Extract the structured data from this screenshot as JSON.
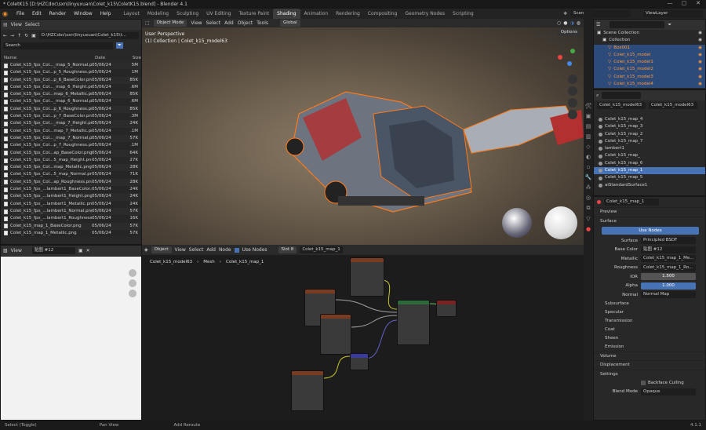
{
  "window": {
    "title": "* ColetK15 [D:\\HZCdoc\\sxn\\linyuxuan\\Colet_k15\\ColetK15.blend] - Blender 4.1"
  },
  "menus": [
    "File",
    "Edit",
    "Render",
    "Window",
    "Help"
  ],
  "workspaces": [
    "Layout",
    "Modeling",
    "Sculpting",
    "UV Editing",
    "Texture Paint",
    "Shading",
    "Animation",
    "Rendering",
    "Compositing",
    "Geometry Nodes",
    "Scripting"
  ],
  "active_workspace": "Shading",
  "scene": {
    "scene_name": "Scene",
    "view_layer": "ViewLayer"
  },
  "file_browser": {
    "view_label": "View",
    "select_label": "Select",
    "path": "D:\\HZCdoc\\sxn\\linyuxuan\\Colet_k15\\t...",
    "search_placeholder": "Search",
    "columns": [
      "Name",
      "Date",
      "Size"
    ],
    "files": [
      {
        "name": "Colet_k15_fpx_Col..._map_5_Normal.png",
        "date": "05/06/24",
        "size": "5M"
      },
      {
        "name": "Colet_k15_fpx_Col...p_5_Roughness.png",
        "date": "05/06/24",
        "size": "1M"
      },
      {
        "name": "Colet_k15_fpx_Col...p_6_BaseColor.png",
        "date": "05/06/24",
        "size": "85K"
      },
      {
        "name": "Colet_k15_fpx_Col..._map_6_Height.png",
        "date": "05/06/24",
        "size": ".6M"
      },
      {
        "name": "Colet_k15_fpx_Col...map_6_Metallic.png",
        "date": "05/06/24",
        "size": "85K"
      },
      {
        "name": "Colet_k15_fpx_Col..._map_6_Normal.png",
        "date": "05/06/24",
        "size": ".6M"
      },
      {
        "name": "Colet_k15_fpx_Col...p_6_Roughness.png",
        "date": "05/06/24",
        "size": "85K"
      },
      {
        "name": "Colet_k15_fpx_Col...p_7_BaseColor.png",
        "date": "05/06/24",
        "size": ".3M"
      },
      {
        "name": "Colet_k15_fpx_Col..._map_7_Height.png",
        "date": "05/06/24",
        "size": "24K"
      },
      {
        "name": "Colet_k15_fpx_Col...map_7_Metallic.png",
        "date": "05/06/24",
        "size": ".1M"
      },
      {
        "name": "Colet_k15_fpx_Col..._map_7_Normal.png",
        "date": "05/06/24",
        "size": "57K"
      },
      {
        "name": "Colet_k15_fpx_Col...p_7_Roughness.png",
        "date": "05/06/24",
        "size": ".1M"
      },
      {
        "name": "Colet_k15_fpx_Col...ap_BaseColor.png",
        "date": "05/06/24",
        "size": "64K"
      },
      {
        "name": "Colet_k15_fpx_Col...5_map_Height.png",
        "date": "05/06/24",
        "size": "27K"
      },
      {
        "name": "Colet_k15_fpx_Col...map_Metallic.png",
        "date": "05/06/24",
        "size": "28K"
      },
      {
        "name": "Colet_k15_fpx_Col...5_map_Normal.png",
        "date": "05/06/24",
        "size": "71K"
      },
      {
        "name": "Colet_k15_fpx_Col...ap_Roughness.png",
        "date": "05/06/24",
        "size": "28K"
      },
      {
        "name": "Colet_k15_fpx_...lambert1_BaseColor.png",
        "date": "05/06/24",
        "size": "24K"
      },
      {
        "name": "Colet_k15_fpx_...lambert1_Height.png",
        "date": "05/06/24",
        "size": "24K"
      },
      {
        "name": "Colet_k15_fpx_...lambert1_Metallic.png",
        "date": "05/06/24",
        "size": "24K"
      },
      {
        "name": "Colet_k15_fpx_...lambert1_Normal.png",
        "date": "05/06/24",
        "size": "57K"
      },
      {
        "name": "Colet_k15_fpx_...lambert1_Roughness.png",
        "date": "05/06/24",
        "size": "16K"
      },
      {
        "name": "Colet_k15_map_1_BaseColor.png",
        "date": "05/06/24",
        "size": "57K"
      },
      {
        "name": "Colet_k15_map_1_Metallic.png",
        "date": "05/06/24",
        "size": "57K"
      }
    ]
  },
  "image_editor": {
    "view_label": "View",
    "image_name": "贴图 #12"
  },
  "viewport": {
    "mode": "Object Mode",
    "menus": [
      "View",
      "Select",
      "Add",
      "Object",
      "Tools"
    ],
    "orientation": "Global",
    "perspective_label": "User Perspective",
    "collection_label": "(1) Collection | Colet_k15_model63",
    "options": "Options"
  },
  "node_editor": {
    "mode": "Object",
    "menus": [
      "View",
      "Select",
      "Add",
      "Node"
    ],
    "use_nodes": "Use Nodes",
    "slot": "Slot 8",
    "material": "Colet_k15_map_1",
    "breadcrumb": [
      "Colet_k15_model63",
      "Mesh",
      "Colet_k15_map_1"
    ]
  },
  "outliner": {
    "search_placeholder": "",
    "items": [
      {
        "label": "Scene Collection",
        "indent": 0
      },
      {
        "label": "Collection",
        "indent": 1
      },
      {
        "label": "Box001",
        "indent": 2
      },
      {
        "label": "Colet_k15_model",
        "indent": 2
      },
      {
        "label": "Colet_k15_model1",
        "indent": 2
      },
      {
        "label": "Colet_k15_model2",
        "indent": 2
      },
      {
        "label": "Colet_k15_model3",
        "indent": 2
      },
      {
        "label": "Colet_k15_model4",
        "indent": 2
      }
    ]
  },
  "material_panel": {
    "object": "Colet_k15_model63",
    "mesh": "Colet_k15_model63",
    "materials": [
      "Colet_k15_map_4",
      "Colet_k15_map_3",
      "Colet_k15_map_2",
      "Colet_k15_map_7",
      "lambert1",
      "Colet_k15_map_",
      "Colet_k15_map_6",
      "Colet_k15_map_1",
      "Colet_k15_map_5",
      "aiStandardSurface1"
    ],
    "active_material": "Colet_k15_map_1"
  },
  "properties": {
    "material_name": "Colet_k15_map_1",
    "sections": {
      "preview": "Preview",
      "surface": "Surface",
      "use_nodes": "Use Nodes",
      "surface_label": "Surface",
      "surface_value": "Principled BSDF",
      "volume": "Volume",
      "displacement": "Displacement",
      "settings": "Settings",
      "backface": "Backface Culling",
      "blend_mode_label": "Blend Mode",
      "blend_mode": "Opaque"
    },
    "rows": [
      {
        "label": "Base Color",
        "value": "贴图 #12"
      },
      {
        "label": "Metallic",
        "value": "Colet_k15_map_1_Me..."
      },
      {
        "label": "Roughness",
        "value": "Colet_k15_map_1_Ro..."
      },
      {
        "label": "IOR",
        "value": "1.500"
      },
      {
        "label": "Alpha",
        "value": "1.000"
      },
      {
        "label": "Normal",
        "value": "Normal Map"
      }
    ],
    "subsections": [
      "Subsurface",
      "Specular",
      "Transmission",
      "Coat",
      "Sheen",
      "Emission"
    ]
  },
  "status": {
    "left": "Select (Toggle)",
    "middle": "Pan View",
    "right": "Add Reroute",
    "version": "4.1.1"
  }
}
